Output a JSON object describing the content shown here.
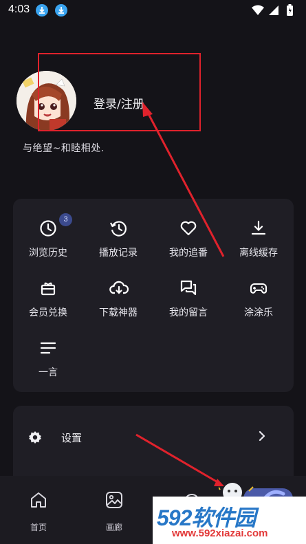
{
  "status_bar": {
    "time": "4:03"
  },
  "profile": {
    "login_label": "登录/注册",
    "motto": "与绝望~和睦相处."
  },
  "menu": {
    "items": [
      {
        "label": "浏览历史",
        "icon": "history-clock-icon",
        "badge": "3"
      },
      {
        "label": "播放记录",
        "icon": "play-record-icon"
      },
      {
        "label": "我的追番",
        "icon": "heart-icon"
      },
      {
        "label": "离线缓存",
        "icon": "download-icon"
      },
      {
        "label": "会员兑换",
        "icon": "gift-icon"
      },
      {
        "label": "下载神器",
        "icon": "cloud-download-icon"
      },
      {
        "label": "我的留言",
        "icon": "chat-icon"
      },
      {
        "label": "涂涂乐",
        "icon": "gamepad-icon"
      },
      {
        "label": "一言",
        "icon": "lines-icon"
      }
    ]
  },
  "settings": {
    "label": "设置"
  },
  "bottom_nav": {
    "items": [
      {
        "label": "首页",
        "icon": "home-icon"
      },
      {
        "label": "画廊",
        "icon": "gallery-icon"
      }
    ]
  },
  "watermark": {
    "number": "592",
    "name": "软件园",
    "site": "www.592xiazai.com"
  },
  "colors": {
    "annotation": "#e0222c",
    "accent": "#3aa4f0",
    "background": "#141318"
  }
}
